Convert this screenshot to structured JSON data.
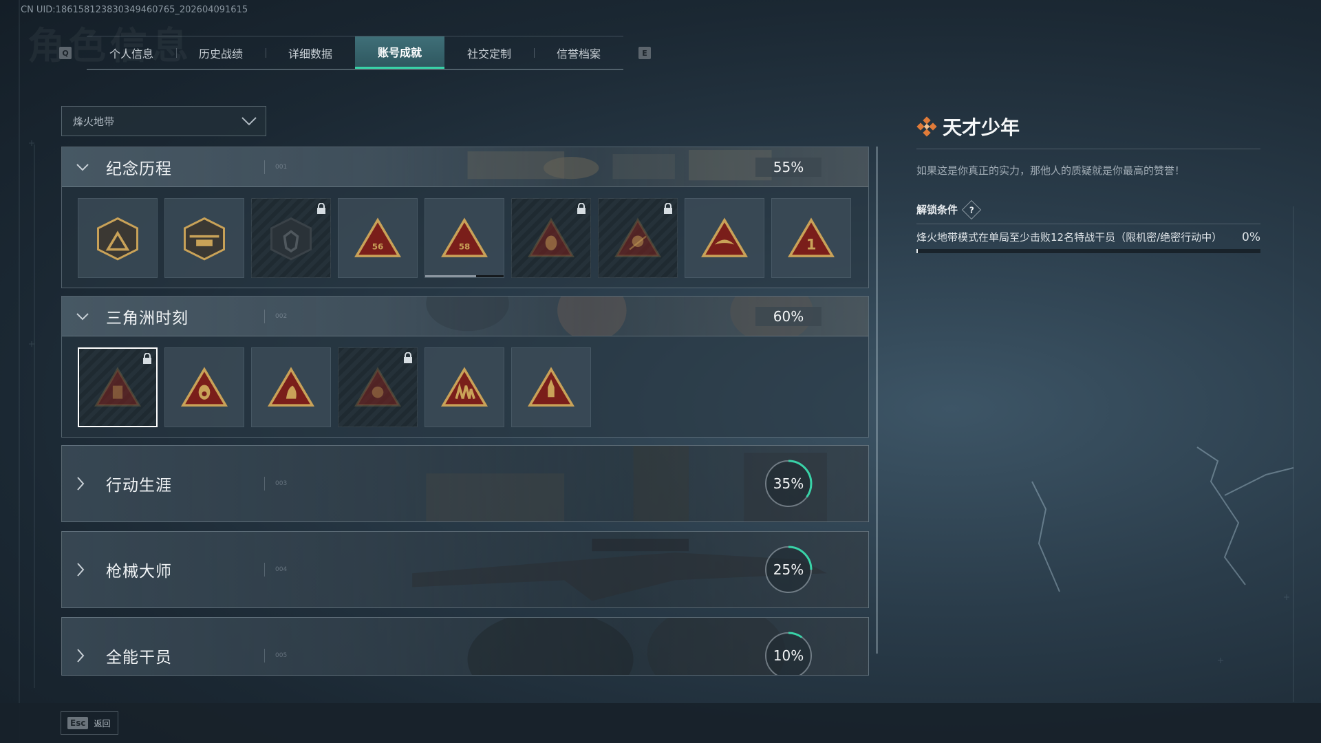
{
  "uid": "CN UID:186158123830349460765_202604091615",
  "ghost_title": "角色信息",
  "tabs": {
    "left_key": "Q",
    "right_key": "E",
    "items": [
      "个人信息",
      "历史战绩",
      "详细数据",
      "账号成就",
      "社交定制",
      "信誉档案"
    ],
    "active_index": 3
  },
  "mode_dropdown": {
    "value": "烽火地带",
    "icon": "chevron-down-icon"
  },
  "categories": [
    {
      "title": "纪念历程",
      "code": "001",
      "progress_text": "55%",
      "progress": 55,
      "expanded": true,
      "badges": [
        {
          "emblem": "delta-mountain",
          "label": "",
          "locked": false
        },
        {
          "emblem": "helicopter",
          "label": "",
          "locked": false
        },
        {
          "emblem": "shield-crest",
          "label": "",
          "locked": true
        },
        {
          "emblem": "skull-56",
          "label": "56",
          "locked": false
        },
        {
          "emblem": "vest-58",
          "label": "58",
          "locked": false,
          "progress": 0.65
        },
        {
          "emblem": "masked-face",
          "label": "",
          "locked": true
        },
        {
          "emblem": "skull-crossed",
          "label": "",
          "locked": true
        },
        {
          "emblem": "eagle-wings",
          "label": "",
          "locked": false
        },
        {
          "emblem": "number-one",
          "label": "1",
          "locked": false
        }
      ]
    },
    {
      "title": "三角洲时刻",
      "code": "002",
      "progress_text": "60%",
      "progress": 60,
      "expanded": true,
      "badges": [
        {
          "emblem": "backpack",
          "label": "",
          "locked": true,
          "selected": true
        },
        {
          "emblem": "gas-mask",
          "label": "",
          "locked": false
        },
        {
          "emblem": "crouching-soldier",
          "label": "",
          "locked": false
        },
        {
          "emblem": "grenade-hands",
          "label": "",
          "locked": true
        },
        {
          "emblem": "squad",
          "label": "",
          "locked": false
        },
        {
          "emblem": "rocket",
          "label": "",
          "locked": false
        }
      ]
    },
    {
      "title": "行动生涯",
      "code": "003",
      "progress_text": "35%",
      "progress": 35,
      "expanded": false
    },
    {
      "title": "枪械大师",
      "code": "004",
      "progress_text": "25%",
      "progress": 25,
      "expanded": false
    },
    {
      "title": "全能干员",
      "code": "005",
      "progress_text": "10%",
      "progress": 10,
      "expanded": false
    }
  ],
  "detail": {
    "icon": "diamond-cluster-icon",
    "title": "天才少年",
    "description": "如果这是你真正的实力，那他人的质疑就是你最高的赞誉！",
    "condition_label": "解锁条件",
    "help_symbol": "?",
    "condition_text": "烽火地带模式在单局至少击败12名特战干员（限机密/绝密行动中）",
    "condition_progress_text": "0%",
    "condition_progress": 0
  },
  "footer": {
    "esc_key": "Esc",
    "esc_label": "返回"
  },
  "colors": {
    "accent_green": "#39d3a8",
    "badge_red": "#7a1e1a",
    "badge_gold": "#c9a258",
    "text_main": "#f1f4f6"
  }
}
